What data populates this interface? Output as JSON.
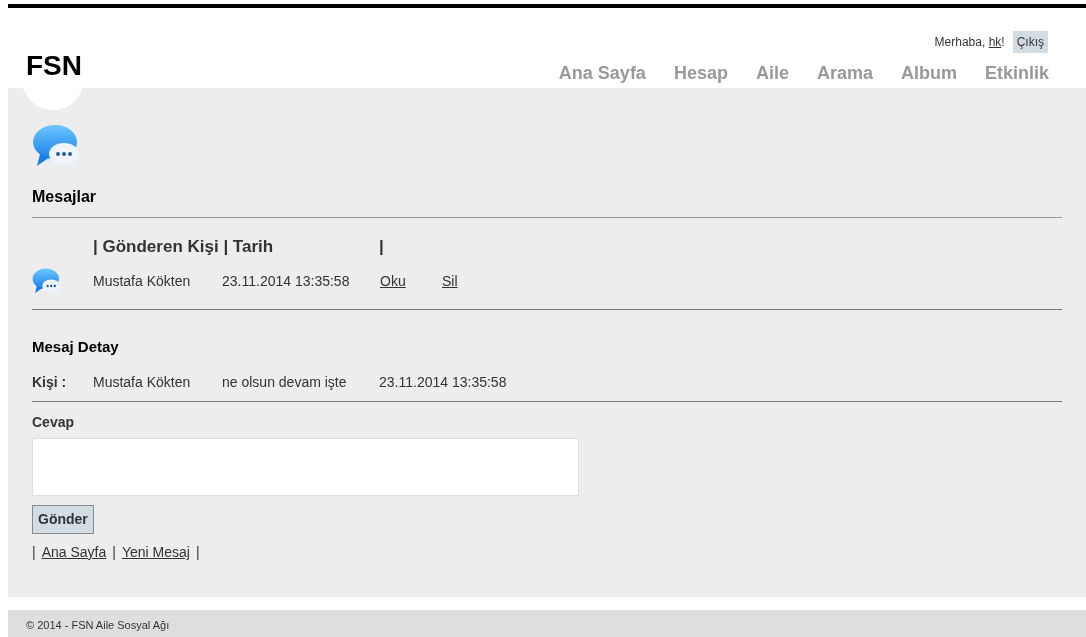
{
  "header": {
    "logo": "FSN",
    "greeting": "Merhaba, ",
    "user": "hk",
    "greeting_end": "!",
    "logout": "Çıkış",
    "nav": [
      {
        "label": "Ana Sayfa"
      },
      {
        "label": "Hesap"
      },
      {
        "label": "Aile"
      },
      {
        "label": "Arama"
      },
      {
        "label": "Album"
      },
      {
        "label": "Etkinlik"
      }
    ]
  },
  "messages": {
    "title": "Mesajlar",
    "header_cells": [
      "| Gönderen Kişi | Tarih",
      "|"
    ],
    "rows": [
      {
        "sender": "Mustafa Kökten",
        "date": "23.11.2014 13:35:58",
        "read_link": "Oku",
        "delete_link": "Sil"
      }
    ]
  },
  "detail": {
    "title": "Mesaj Detay",
    "label": "Kişi :",
    "sender": "Mustafa Kökten",
    "message": "ne olsun devam işte",
    "date": "23.11.2014 13:35:58"
  },
  "reply": {
    "label": "Cevap",
    "button": "Gönder"
  },
  "links": [
    {
      "kind": "separator",
      "text": "|"
    },
    {
      "kind": "link",
      "text": "Ana Sayfa"
    },
    {
      "kind": "separator",
      "text": "|"
    },
    {
      "kind": "link",
      "text": "Yeni Mesaj"
    },
    {
      "kind": "separator",
      "text": "|"
    }
  ],
  "footer": "© 2014 - FSN Aile Sosyal Ağı"
}
